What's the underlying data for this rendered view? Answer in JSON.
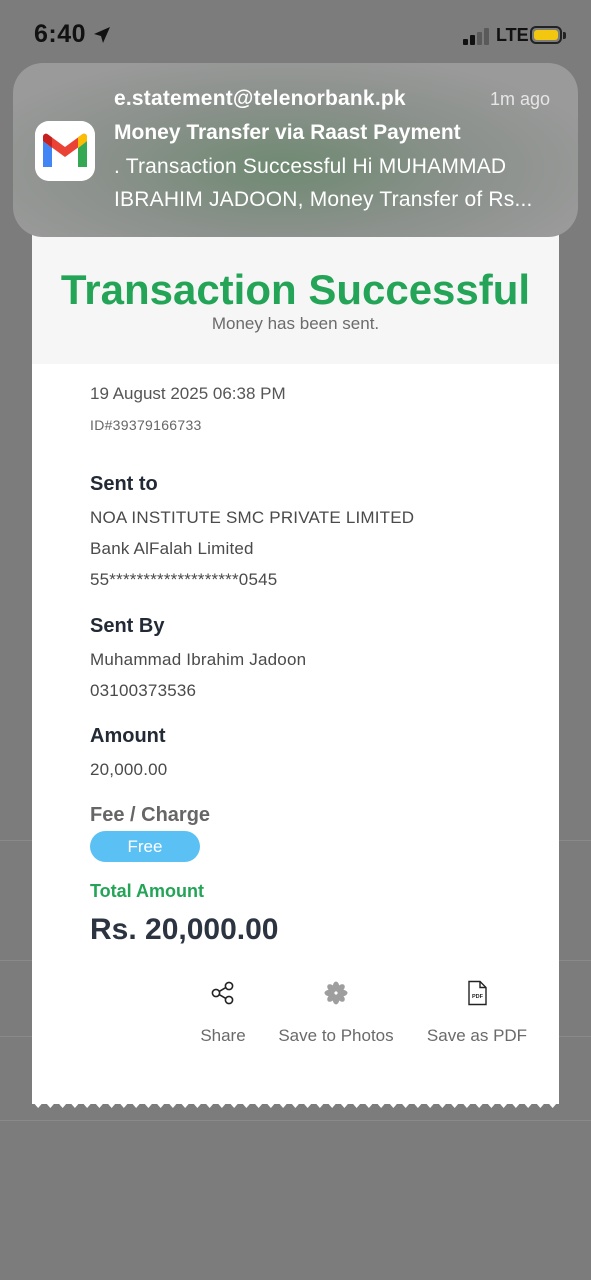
{
  "status_bar": {
    "time": "6:40",
    "network": "LTE",
    "battery_color": "#f3c70f"
  },
  "notification": {
    "app_icon": "gmail-icon",
    "sender": "e.statement@telenorbank.pk",
    "time_ago": "1m ago",
    "subject": "Money Transfer via Raast Payment",
    "preview_line1": ". Transaction Successful Hi MUHAMMAD",
    "preview_line2": "IBRAHIM JADOON, Money Transfer of Rs..."
  },
  "receipt": {
    "title": "Transaction Successful",
    "subtitle": "Money has been sent.",
    "datetime": "19 August 2025 06:38 PM",
    "transaction_id": "ID#39379166733",
    "sent_to": {
      "label": "Sent to",
      "name": "NOA INSTITUTE SMC PRIVATE LIMITED",
      "bank": "Bank AlFalah Limited",
      "account": "55*******************0545"
    },
    "sent_by": {
      "label": "Sent By",
      "name": "Muhammad Ibrahim Jadoon",
      "phone": "03100373536"
    },
    "amount": {
      "label": "Amount",
      "value": "20,000.00"
    },
    "fee": {
      "label": "Fee / Charge",
      "badge": "Free"
    },
    "total": {
      "label": "Total Amount",
      "value": "Rs. 20,000.00"
    },
    "actions": [
      {
        "label": "Share",
        "icon": "share-icon"
      },
      {
        "label": "Save to Photos",
        "icon": "photos-icon"
      },
      {
        "label": "Save as PDF",
        "icon": "pdf-icon"
      }
    ],
    "accent_color": "#23a457",
    "badge_color": "#5bc1f4"
  }
}
